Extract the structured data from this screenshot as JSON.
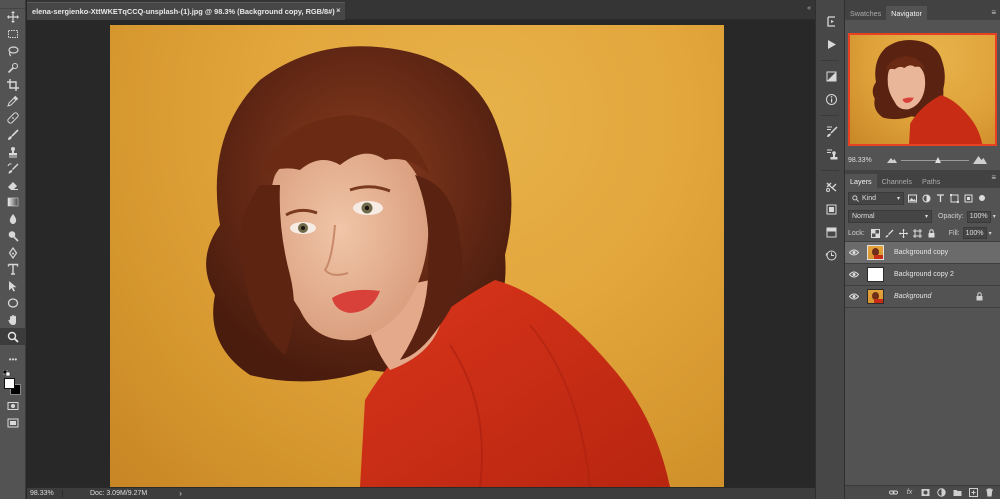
{
  "document": {
    "tab_title": "elena-sergienko-XttWKETqCCQ-unsplash-(1).jpg @ 98.3% (Background copy, RGB/8#) *",
    "close_symbol": "×"
  },
  "toolbar": {
    "tools": [
      "move-tool",
      "marquee-tool",
      "lasso-tool",
      "quick-select-tool",
      "crop-tool",
      "eyedropper-tool",
      "healing-tool",
      "brush-tool",
      "clone-stamp-tool",
      "history-brush-tool",
      "eraser-tool",
      "gradient-tool",
      "blur-tool",
      "dodge-tool",
      "pen-tool",
      "type-tool",
      "path-select-tool",
      "shape-tool",
      "hand-tool",
      "zoom-tool"
    ],
    "active_tool": "zoom-tool",
    "more_tools": "•••",
    "foreground_color": "#ffffff",
    "background_color": "#000000"
  },
  "statusbar": {
    "zoom": "98.33%",
    "doc_size": "Doc: 3.09M/9.27M",
    "arrow": "›"
  },
  "navigator": {
    "tabs": [
      "Swatches",
      "Navigator"
    ],
    "active_tab": "Navigator",
    "zoom": "98.33%",
    "slider_level": 0.55,
    "view_box_color": "#e84023"
  },
  "layers_panel": {
    "tabs": [
      "Layers",
      "Channels",
      "Paths"
    ],
    "active_tab": "Layers",
    "filter_kind": "Kind",
    "blend_mode": "Normal",
    "opacity_label": "Opacity:",
    "opacity_value": "100%",
    "lock_label": "Lock:",
    "fill_label": "Fill:",
    "fill_value": "100%",
    "layers": [
      {
        "name": "Background copy",
        "selected": true,
        "thumb": "photo",
        "italic": false,
        "locked": false
      },
      {
        "name": "Background copy 2",
        "selected": false,
        "thumb": "blank",
        "italic": false,
        "locked": false
      },
      {
        "name": "Background",
        "selected": false,
        "thumb": "photo",
        "italic": true,
        "locked": true
      }
    ],
    "footer_icons": [
      "link-icon",
      "fx-icon",
      "mask-icon",
      "adjustment-icon",
      "folder-icon",
      "new-layer-icon",
      "trash-icon"
    ],
    "fx_label": "fx"
  },
  "panel_menu_symbol": "≡",
  "colors": {
    "accent_red": "#e84023",
    "backdrop": "#e2a63c",
    "sweater": "#c92c14"
  }
}
